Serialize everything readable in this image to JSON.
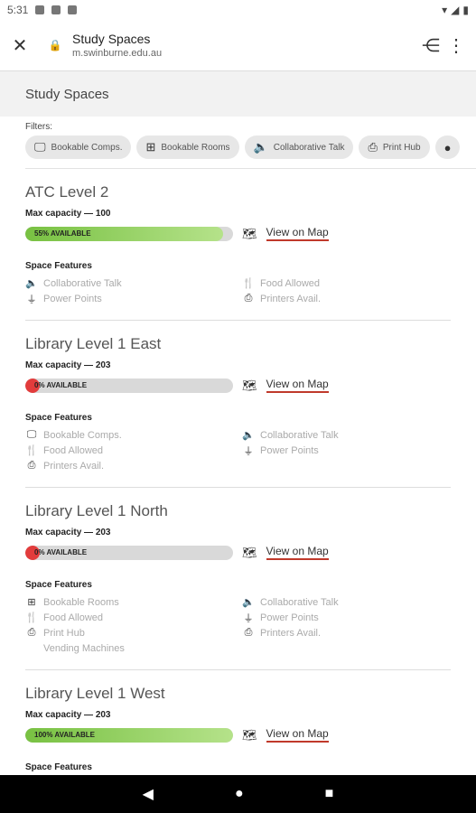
{
  "statusbar": {
    "time": "5:31"
  },
  "toolbar": {
    "title": "Study Spaces",
    "url": "m.swinburne.edu.au",
    "close_icon": "close-icon",
    "share_icon": "share-icon",
    "menu_icon": "more-vert-icon"
  },
  "page_title": "Study Spaces",
  "filters": {
    "label": "Filters:",
    "chips": [
      {
        "label": "Bookable Comps.",
        "icon": "computer-icon"
      },
      {
        "label": "Bookable Rooms",
        "icon": "meeting-room-icon"
      },
      {
        "label": "Collaborative Talk",
        "icon": "volume-icon"
      },
      {
        "label": "Print Hub",
        "icon": "print-search-icon"
      }
    ]
  },
  "spaces": [
    {
      "title": "ATC Level 2",
      "capacity": "Max capacity — 100",
      "available": "55% AVAILABLE",
      "available_fraction": 0.95,
      "map_label": "View on Map",
      "features_title": "Space Features",
      "features": [
        "Collaborative Talk",
        "Food Allowed",
        "Power Points",
        "Printers Avail."
      ]
    },
    {
      "title": "Library Level 1 East",
      "capacity": "Max capacity — 203",
      "available": "0% AVAILABLE",
      "available_fraction": 0.0,
      "map_label": "View on Map",
      "features_title": "Space Features",
      "features": [
        "Bookable Comps.",
        "Collaborative Talk",
        "Food Allowed",
        "Power Points",
        "Printers Avail."
      ]
    },
    {
      "title": "Library Level 1 North",
      "capacity": "Max capacity — 203",
      "available": "0% AVAILABLE",
      "available_fraction": 0.0,
      "map_label": "View on Map",
      "features_title": "Space Features",
      "features": [
        "Bookable Rooms",
        "Collaborative Talk",
        "Food Allowed",
        "Power Points",
        "Print Hub",
        "Printers Avail.",
        "Vending Machines"
      ]
    },
    {
      "title": "Library Level 1 West",
      "capacity": "Max capacity — 203",
      "available": "100% AVAILABLE",
      "available_fraction": 1.0,
      "map_label": "View on Map",
      "features_title": "Space Features"
    }
  ]
}
